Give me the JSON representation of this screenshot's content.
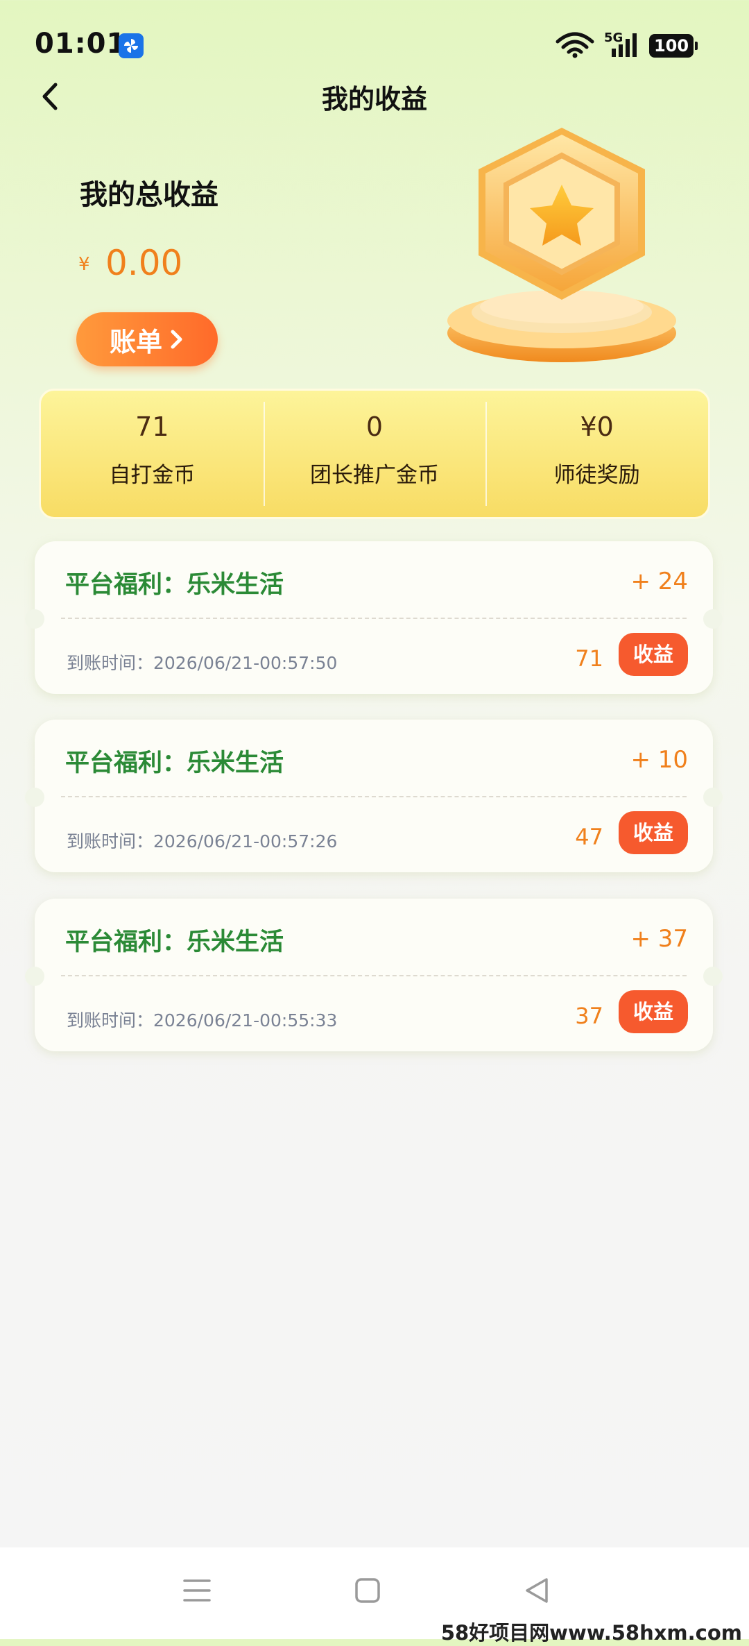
{
  "status_bar": {
    "time": "01:01",
    "network": "5G",
    "battery": "100"
  },
  "header": {
    "title": "我的收益",
    "back_icon": "chevron-left-icon"
  },
  "summary": {
    "label": "我的总收益",
    "currency_symbol": "¥",
    "amount": "0.00",
    "bill_button": "账单"
  },
  "stats": [
    {
      "value": "71",
      "label": "自打金币"
    },
    {
      "value": "0",
      "label": "团长推广金币"
    },
    {
      "value": "¥0",
      "label": "师徒奖励"
    }
  ],
  "records": [
    {
      "title": "平台福利：乐米生活",
      "delta": "+ 24",
      "time": "到账时间：2026/06/21-00:57:50",
      "count": "71",
      "button": "收益"
    },
    {
      "title": "平台福利：乐米生活",
      "delta": "+ 10",
      "time": "到账时间：2026/06/21-00:57:26",
      "count": "47",
      "button": "收益"
    },
    {
      "title": "平台福利：乐米生活",
      "delta": "+ 37",
      "time": "到账时间：2026/06/21-00:55:33",
      "count": "37",
      "button": "收益"
    }
  ],
  "watermark": "58好项目网www.58hxm.com",
  "colors": {
    "accent_orange": "#f0801c",
    "green_title": "#2b8a36",
    "button_red": "#f65a2e"
  }
}
